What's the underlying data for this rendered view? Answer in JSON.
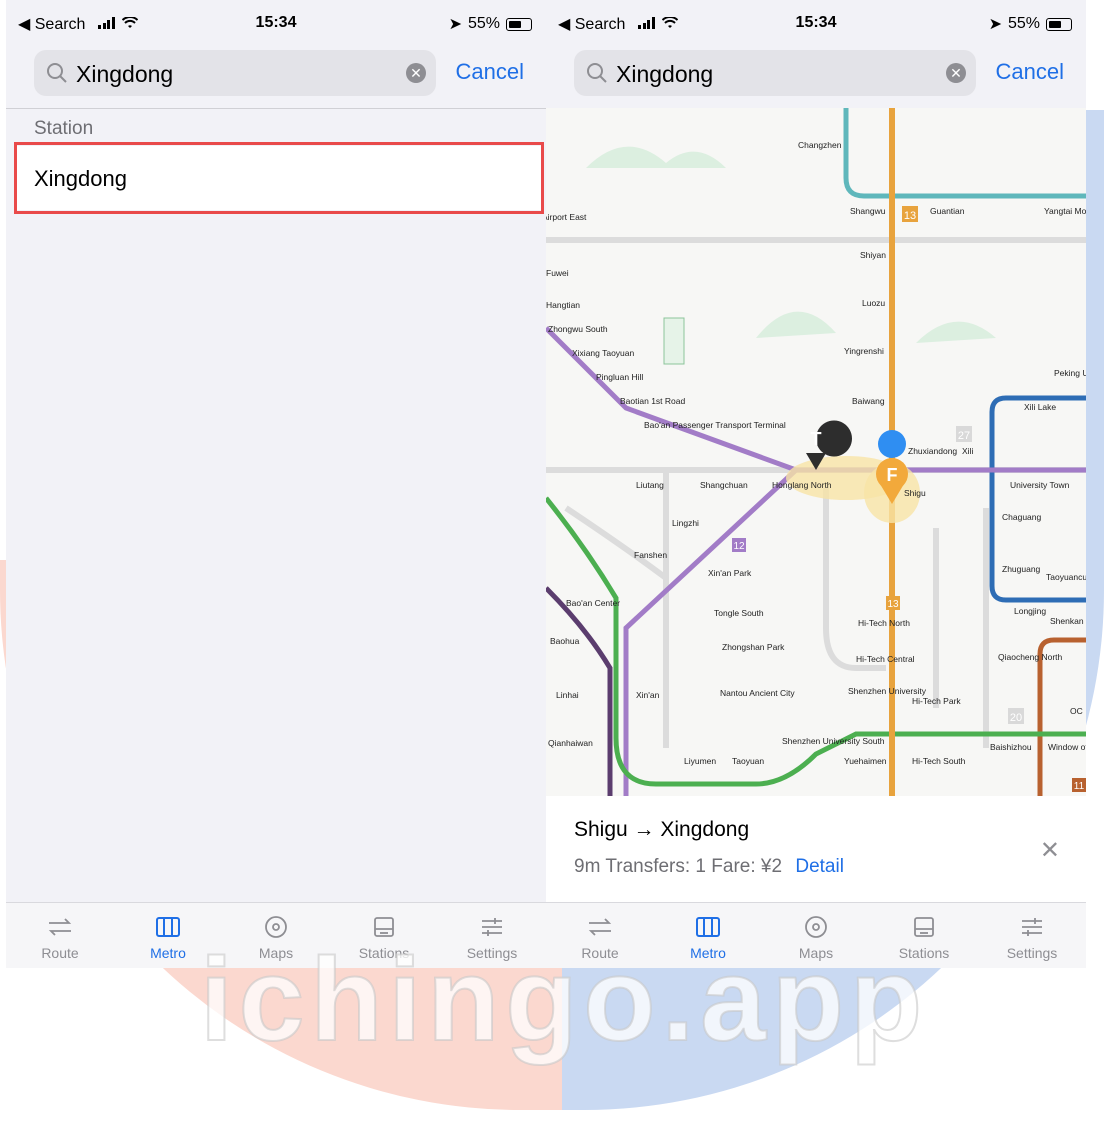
{
  "status_left": {
    "back": "◀ Search",
    "time": "15:34",
    "battery": "55%"
  },
  "status_right": {
    "back": "◀ Search",
    "time": "15:34",
    "battery": "55%"
  },
  "search_left": {
    "value": "Xingdong",
    "cancel": "Cancel"
  },
  "search_right": {
    "value": "Xingdong",
    "cancel": "Cancel"
  },
  "results": {
    "section_title": "Station",
    "items": [
      {
        "label": "Xingdong"
      }
    ]
  },
  "route": {
    "title": "Shigu → Xingdong",
    "duration": "9m",
    "transfers": "Transfers: 1",
    "fare": "Fare: ¥2",
    "detail": "Detail"
  },
  "tabs": [
    {
      "label": "Route",
      "icon": "route-icon"
    },
    {
      "label": "Metro",
      "icon": "metro-map-icon"
    },
    {
      "label": "Maps",
      "icon": "location-pin-icon"
    },
    {
      "label": "Stations",
      "icon": "stations-icon"
    },
    {
      "label": "Settings",
      "icon": "settings-sliders-icon"
    }
  ],
  "active_tab": "Metro",
  "map": {
    "stations": [
      "Changzhen",
      "Shangwu",
      "Guantian",
      "Yangtai Mo",
      "Shiyan",
      "Luozu",
      "Yingrenshi",
      "Baiwang",
      "Peking U",
      "Xili Lake",
      "Xili",
      "Zhuxiandong",
      "Shigu",
      "University Town",
      "Chaguang",
      "Zhuguang",
      "Taoyuancu",
      "Longjing",
      "Shenkan",
      "Honglang North",
      "Shangchuan",
      "Liutang",
      "Lingzhi",
      "Fanshen",
      "Xin'an Park",
      "Tongle South",
      "Zhongshan Park",
      "Nantou Ancient City",
      "Bao'an Center",
      "Baohua",
      "Linhai",
      "Xin'an",
      "Qianhaiwan",
      "Liyumen",
      "Taoyuan",
      "Shenzhen University South",
      "Yuehaimen",
      "Hi-Tech South",
      "Hi-Tech North",
      "Hi-Tech Central",
      "Shenzhen University",
      "Hi-Tech Park",
      "Qiaocheng North",
      "Baishizhou",
      "Window of the World",
      "Zhongwu South",
      "Xixiang Taoyuan",
      "Pingluan Hill",
      "Baotian 1st Road",
      "Bao'an Passenger Transport Terminal",
      "Airport East",
      "Fuwei",
      "Hangtian",
      "OC"
    ],
    "line_numbers": [
      "13",
      "27",
      "12",
      "13",
      "20",
      "11"
    ],
    "markers": {
      "to": "T",
      "from": "F"
    }
  },
  "colors": {
    "accent": "#1f6fe6",
    "highlight": "#e94a4a",
    "line_orange": "#e8a33d",
    "line_purple": "#a27cc7",
    "line_teal": "#5fb7bb",
    "line_green": "#4caf50",
    "line_blue": "#2e6db5",
    "line_brown": "#b8612f",
    "line_darkpurple": "#5b3d6e"
  },
  "watermark": "ichingo.app"
}
